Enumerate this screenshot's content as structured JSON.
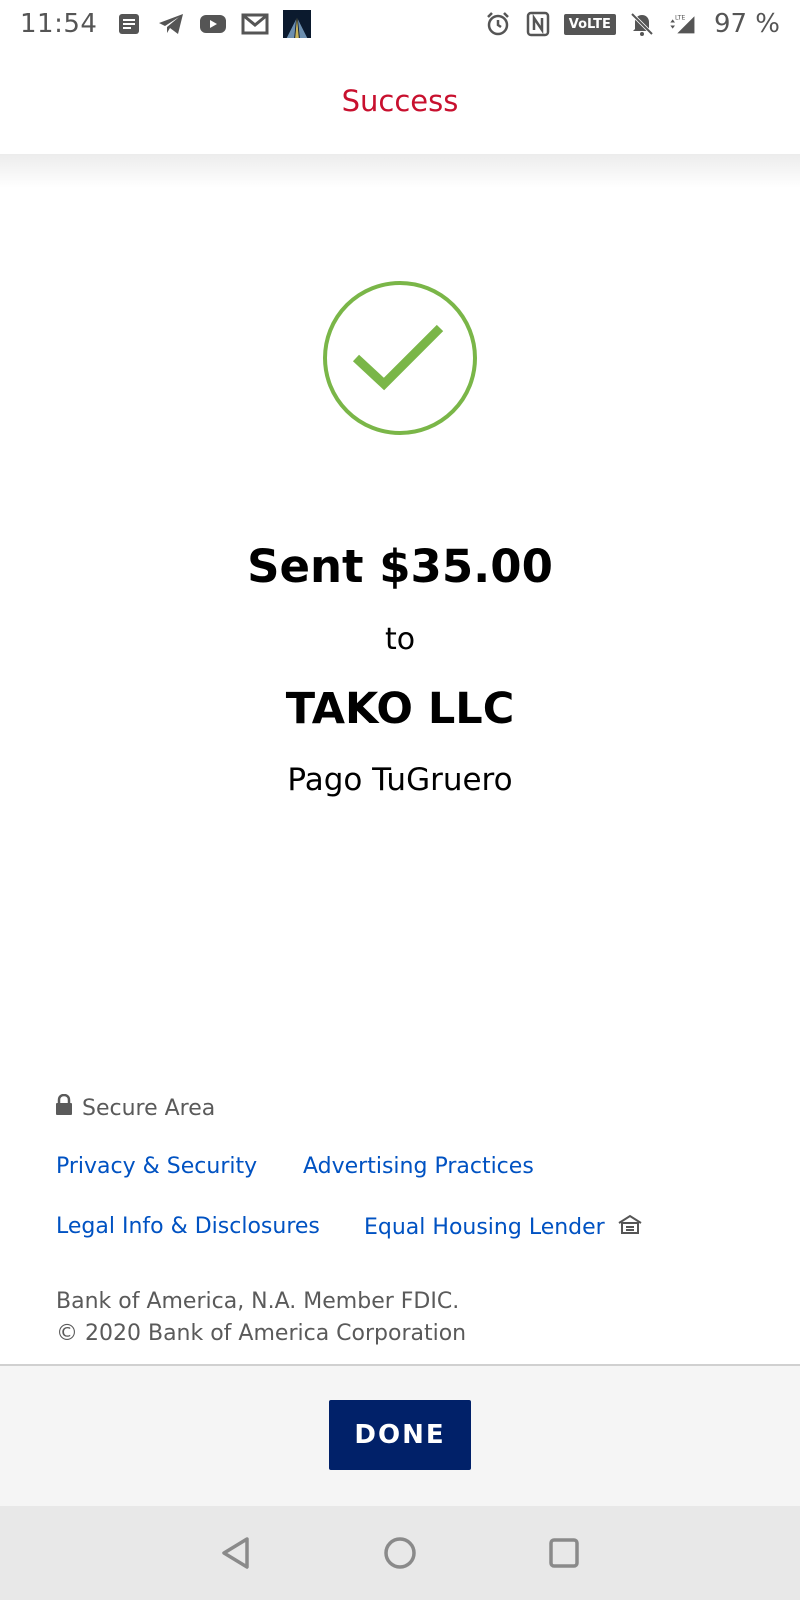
{
  "status_bar": {
    "time": "11:54",
    "battery": "97 %",
    "volte_label": "VoLTE",
    "left_icons": [
      "notes-icon",
      "telegram-icon",
      "youtube-icon",
      "gmail-icon",
      "app-thumbnail-icon"
    ],
    "right_icons": [
      "alarm-icon",
      "nfc-icon",
      "volte-icon",
      "mute-icon",
      "signal-icon"
    ]
  },
  "header": {
    "title": "Success",
    "title_color": "#c8102e"
  },
  "confirmation": {
    "icon": "check-circle-icon",
    "icon_color": "#7ab648",
    "amount": "Sent $35.00",
    "to": "to",
    "recipient": "TAKO LLC",
    "memo": "Pago TuGruero"
  },
  "footer": {
    "secure_label": "Secure Area",
    "links": {
      "privacy": "Privacy & Security",
      "advertising": "Advertising Practices",
      "legal": "Legal Info & Disclosures",
      "equal_housing": "Equal Housing Lender"
    },
    "legal_line1": "Bank of America, N.A. Member FDIC.",
    "legal_line2": "© 2020 Bank of America Corporation",
    "link_color": "#0052c2"
  },
  "actions": {
    "done_label": "DONE",
    "done_color": "#012169"
  },
  "nav": {
    "back": "back-icon",
    "home": "home-icon",
    "recents": "recents-icon"
  }
}
